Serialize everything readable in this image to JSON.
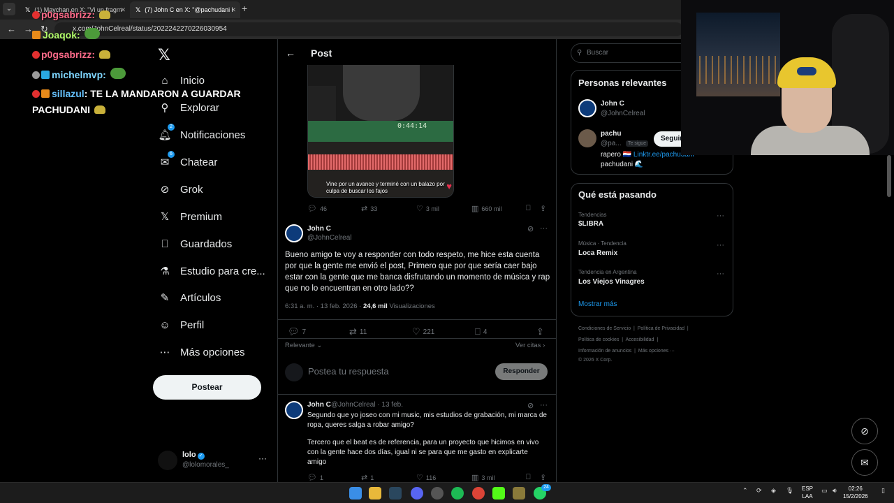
{
  "browser": {
    "tabs": [
      {
        "label": "(1) Maychan en X: \"Vi un fragm",
        "active": false
      },
      {
        "label": "(7) John C en X: \"@pachudani l",
        "active": true
      }
    ],
    "url": "x.com/JohnCelreal/status/2022242270226030954"
  },
  "chat": [
    {
      "user": "p0gsabrizz:",
      "msg": ""
    },
    {
      "user": "Joaqok:",
      "msg": ""
    },
    {
      "user": "p0gsabrizz:",
      "msg": ""
    },
    {
      "user": "michelmvp:",
      "msg": ""
    },
    {
      "user": "sillazul",
      "msg": ": TE LA MANDARON A GUARDAR"
    },
    {
      "user": "",
      "msg": "PACHUDANI"
    }
  ],
  "nav": {
    "items": [
      "Inicio",
      "Explorar",
      "Notificaciones",
      "Chatear",
      "Grok",
      "Premium",
      "Guardados",
      "Estudio para cre...",
      "Artículos",
      "Perfil",
      "Más opciones"
    ],
    "badges": {
      "notifications": "2",
      "chat": "6"
    },
    "post_button": "Postear"
  },
  "account": {
    "name": "lolo",
    "handle": "@lolomorales_"
  },
  "main": {
    "header_title": "Post",
    "media": {
      "timecode": "0:44:14",
      "caption": "Vine por un avance y terminé con un balazo por culpa de buscar los fajos"
    },
    "quoted_actions": {
      "replies": "46",
      "reposts": "33",
      "likes": "3 mil",
      "views": "660 mil"
    },
    "tweet": {
      "name": "John C",
      "handle": "@JohnCelreal",
      "text": "Bueno amigo te voy a responder con todo respeto, me hice esta cuenta por que la gente me envió el post, Primero que por que sería caer bajo estar con la gente que me banca disfrutando un momento de música y rap que no lo encuentran en otro lado??",
      "time": "6:31 a. m. · 13 feb. 2026 ·",
      "views_count": "24,6 mil",
      "views_label": "Visualizaciones",
      "replies": "7",
      "reposts": "11",
      "likes": "221",
      "bookmarks": "4"
    },
    "sort_label": "Relevante",
    "quotes_link": "Ver citas",
    "reply_placeholder": "Postea tu respuesta",
    "reply_button": "Responder",
    "reply": {
      "name": "John C",
      "handle": "@JohnCelreal · 13 feb.",
      "text1": "Segundo que yo joseo con mi music, mis estudios de grabación, mi marca de ropa, queres salga a robar amigo?",
      "text2": "Tercero que el beat es de referencia, para un proyecto que hicimos en vivo con la gente hace dos días, igual ni se para que me gasto en explicarte amigo",
      "replies": "1",
      "reposts": "1",
      "likes": "116",
      "views": "3 mil"
    }
  },
  "right": {
    "search_placeholder": "Buscar",
    "relevant": {
      "title": "Personas relevantes",
      "people": [
        {
          "name": "John C",
          "handle": "@JohnCelreal"
        },
        {
          "name": "pachu",
          "handle": "@pa...",
          "follows_you": "Te sigue",
          "follow": "Seguir"
        }
      ],
      "bio_prefix": "rapero 🇵🇾",
      "bio_link": "Linktr.ee/pachudani",
      "bio_line2": "pachudani 🌊"
    },
    "trends": {
      "title": "Qué está pasando",
      "items": [
        {
          "category": "Tendencias",
          "name": "$LIBRA"
        },
        {
          "category": "Música · Tendencia",
          "name": "Loca Remix"
        },
        {
          "category": "Tendencia en Argentina",
          "name": "Los Viejos Vinagres"
        }
      ],
      "show_more": "Mostrar más"
    },
    "footer": {
      "line1": [
        "Condiciones de Servicio",
        "Política de Privacidad"
      ],
      "line2": [
        "Política de cookies",
        "Accesibilidad"
      ],
      "line3": [
        "Información de anuncios",
        "Más opciones ···"
      ],
      "copyright": "© 2026 X Corp."
    }
  },
  "taskbar": {
    "lang1": "ESP",
    "lang2": "LAA",
    "time": "02:26",
    "date": "15/2/2026",
    "whatsapp_badge": "24"
  }
}
